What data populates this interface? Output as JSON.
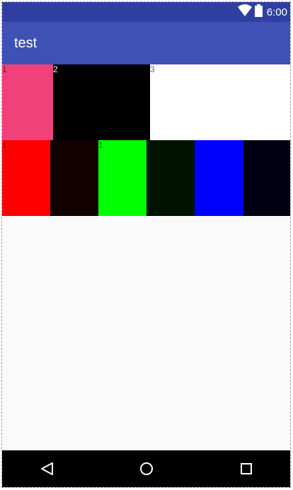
{
  "status_bar": {
    "time": "6:00",
    "wifi_icon": "wifi-icon",
    "battery_icon": "battery-icon"
  },
  "app_bar": {
    "title": "test"
  },
  "row1": [
    {
      "label": "1",
      "color": "#f0417a",
      "label_color": "#5a1b30"
    },
    {
      "label": "2",
      "color": "#000000",
      "label_color": "#ffffff"
    },
    {
      "label": "3",
      "color": "#ffffff",
      "label_color": "#6d6d6d"
    }
  ],
  "row2": [
    {
      "label": "1",
      "color": "#ff0000",
      "label_color": "#8a0000"
    },
    {
      "label": "",
      "color": "#120000",
      "label_color": "#3a0000"
    },
    {
      "label": "1",
      "color": "#00ff00",
      "label_color": "#007a00"
    },
    {
      "label": "",
      "color": "#001200",
      "label_color": "#003a00"
    },
    {
      "label": "",
      "color": "#0000ff",
      "label_color": "#00007a"
    },
    {
      "label": "",
      "color": "#000012",
      "label_color": "#00003a"
    }
  ],
  "nav_bar": {
    "back_icon": "back-triangle-icon",
    "home_icon": "home-circle-icon",
    "recents_icon": "recents-square-icon"
  }
}
